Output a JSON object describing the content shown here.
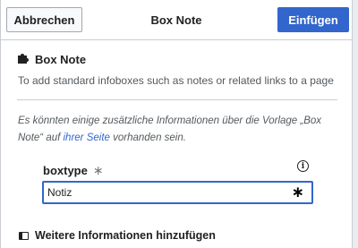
{
  "header": {
    "cancel_label": "Abbrechen",
    "title": "Box Note",
    "insert_label": "Einfügen"
  },
  "template": {
    "icon": "puzzle-piece-icon",
    "name": "Box Note",
    "description": "To add standard infoboxes such as notes or related links to a page"
  },
  "note": {
    "text_before": "Es könnten einige zusätzliche Informationen über die Vorlage „Box Note“ auf ",
    "link_text": "ihrer Seite",
    "text_after": " vorhanden sein."
  },
  "parameter": {
    "label": "boxtype",
    "required_marker": "∗",
    "info_icon": "info-icon",
    "value": "Notiz",
    "input_marker": "∗"
  },
  "more_info": {
    "icon": "panel-toggle-icon",
    "label": "Weitere Informationen hinzufügen"
  },
  "colors": {
    "primary": "#3366cc",
    "border": "#c8ccd1",
    "text": "#202122",
    "muted_text": "#54595d"
  }
}
